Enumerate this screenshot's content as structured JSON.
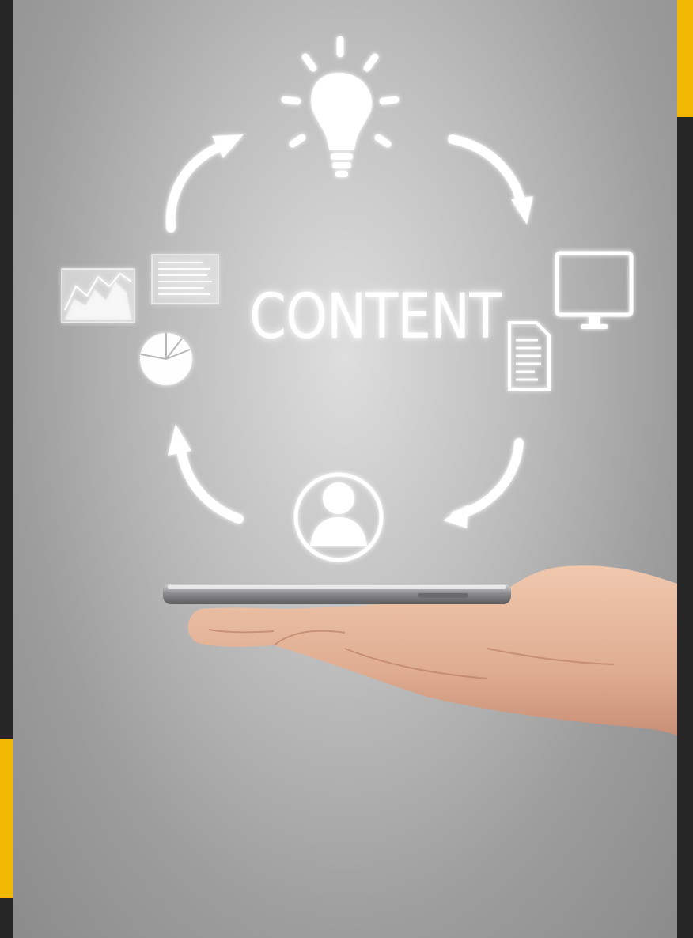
{
  "image": {
    "headline_word": "CONTENT",
    "icons": [
      "lightbulb-icon",
      "monitor-icon",
      "document-icon",
      "user-icon",
      "pie-chart-icon",
      "line-chart-icon",
      "text-sheet-icon"
    ],
    "colors": {
      "accent": "#f0b800",
      "frame": "#262626",
      "icon_glow": "#ffffff",
      "skin": "#e3b59a",
      "phone": "#9a9a9c"
    }
  }
}
